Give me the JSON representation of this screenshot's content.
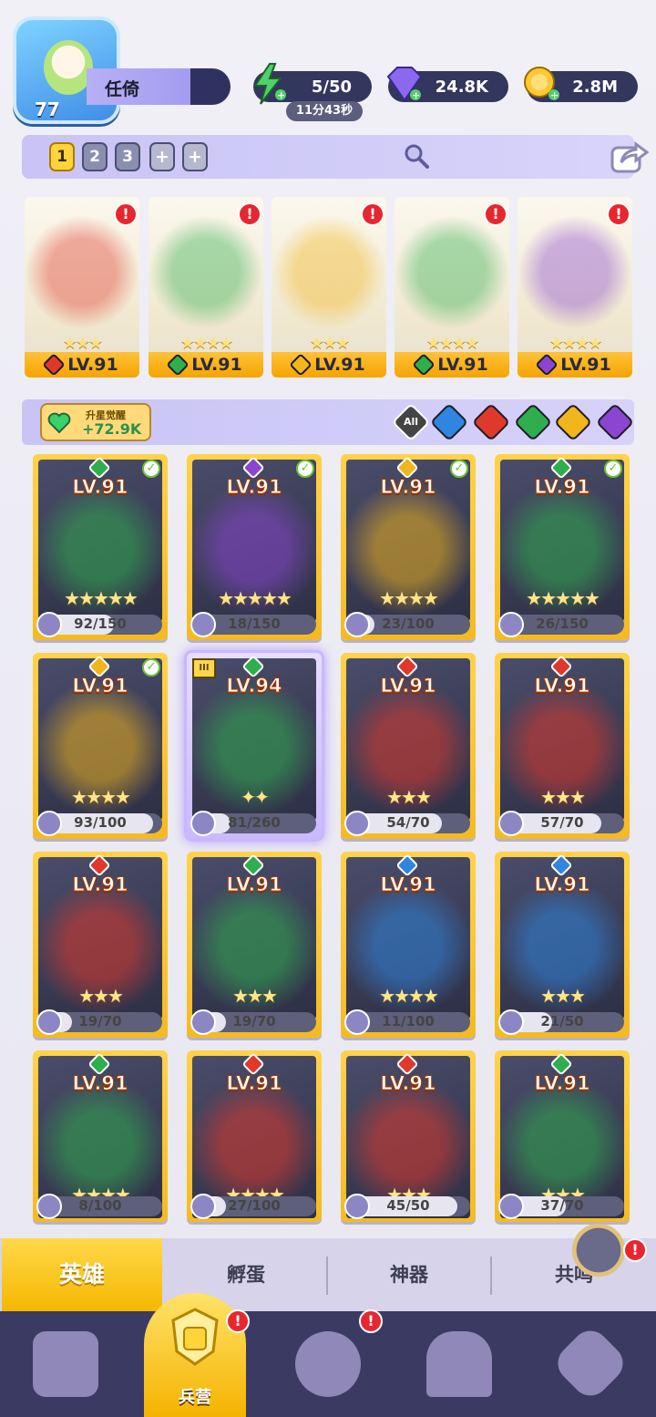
{
  "player": {
    "level": "77",
    "name": "任倚"
  },
  "resources": {
    "energy": "5/50",
    "energy_timer": "11分43秒",
    "gems": "24.8K",
    "coins": "2.8M"
  },
  "lineup": {
    "slots": [
      "1",
      "2",
      "3"
    ],
    "active_slot": "1",
    "add_symbol": "+"
  },
  "team": [
    {
      "level": "LV.91",
      "element": "fire",
      "stars": "★★★"
    },
    {
      "level": "LV.91",
      "element": "nature",
      "stars": "★★★★"
    },
    {
      "level": "LV.91",
      "element": "light",
      "stars": "★★★"
    },
    {
      "level": "LV.91",
      "element": "nature",
      "stars": "★★★★"
    },
    {
      "level": "LV.91",
      "element": "dark",
      "stars": "★★★★"
    }
  ],
  "awaken": {
    "title": "升星觉醒",
    "value": "+72.9K"
  },
  "filters": {
    "all_label": "All",
    "elements": [
      "water",
      "fire",
      "nature",
      "light",
      "dark"
    ]
  },
  "element_colors": {
    "fire": "#e0392b",
    "nature": "#2fae4e",
    "light": "#f2b51b",
    "dark": "#8a46d0",
    "water": "#2f86e0"
  },
  "heroes": [
    {
      "level": "LV.91",
      "element": "nature",
      "stars": "★★★★★",
      "progress": "92/150",
      "owned": true
    },
    {
      "level": "LV.91",
      "element": "dark",
      "stars": "★★★★★",
      "progress": "18/150",
      "owned": true
    },
    {
      "level": "LV.91",
      "element": "light",
      "stars": "★★★★",
      "progress": "23/100",
      "owned": true
    },
    {
      "level": "LV.91",
      "element": "nature",
      "stars": "★★★★★",
      "progress": "26/150",
      "owned": true
    },
    {
      "level": "LV.91",
      "element": "light",
      "stars": "★★★★",
      "progress": "93/100",
      "owned": true
    },
    {
      "level": "LV.94",
      "element": "nature",
      "stars": "✦✦",
      "progress": "81/260",
      "owned": false,
      "special": true,
      "rank": "III"
    },
    {
      "level": "LV.91",
      "element": "fire",
      "stars": "★★★",
      "progress": "54/70",
      "owned": false
    },
    {
      "level": "LV.91",
      "element": "fire",
      "stars": "★★★",
      "progress": "57/70",
      "owned": false
    },
    {
      "level": "LV.91",
      "element": "fire",
      "stars": "★★★",
      "progress": "19/70",
      "owned": false
    },
    {
      "level": "LV.91",
      "element": "nature",
      "stars": "★★★",
      "progress": "19/70",
      "owned": false
    },
    {
      "level": "LV.91",
      "element": "water",
      "stars": "★★★★",
      "progress": "11/100",
      "owned": false
    },
    {
      "level": "LV.91",
      "element": "water",
      "stars": "★★★",
      "progress": "21/50",
      "owned": false
    },
    {
      "level": "LV.91",
      "element": "nature",
      "stars": "★★★★",
      "progress": "8/100",
      "owned": false
    },
    {
      "level": "LV.91",
      "element": "fire",
      "stars": "★★★★",
      "progress": "27/100",
      "owned": false
    },
    {
      "level": "LV.91",
      "element": "fire",
      "stars": "★★★",
      "progress": "45/50",
      "owned": false
    },
    {
      "level": "LV.91",
      "element": "nature",
      "stars": "★★★",
      "progress": "37/70",
      "owned": false
    }
  ],
  "tabs": [
    "英雄",
    "孵蛋",
    "神器",
    "共鸣"
  ],
  "nav": {
    "active_label": "兵营"
  }
}
